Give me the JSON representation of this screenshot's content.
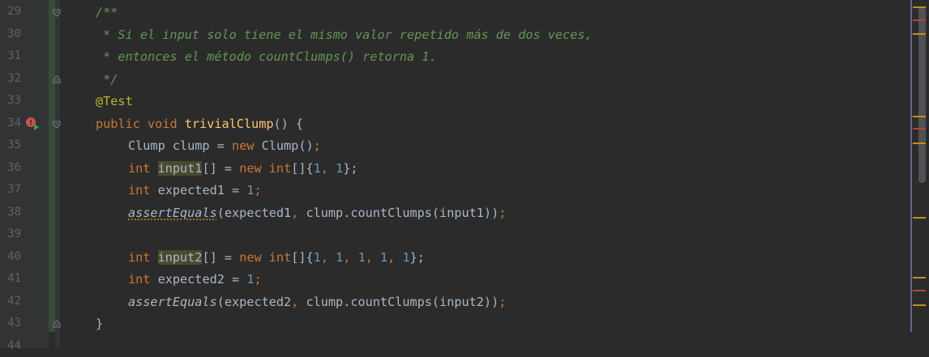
{
  "editor": {
    "line_numbers": [
      "29",
      "30",
      "31",
      "32",
      "33",
      "34",
      "35",
      "36",
      "37",
      "38",
      "39",
      "40",
      "41",
      "42",
      "43",
      "44"
    ],
    "comment_open": "/**",
    "comment_line1": " * Si el input solo tiene el mismo valor repetido más de dos veces,",
    "comment_line2": " * entonces el método countClumps() retorna 1.",
    "comment_close": " */",
    "annotation": "@Test",
    "method": {
      "kw_public": "public",
      "kw_void": "void",
      "name": "trivialClump",
      "rest": "() {"
    },
    "line35": {
      "type": "Clump clump = ",
      "kw_new": "new",
      "rest": " Clump()",
      "semi": ";"
    },
    "line36": {
      "kw_int": "int",
      "var": "input1",
      "brackets": "[] = ",
      "kw_new": "new",
      "kw_int2": "int",
      "arr_open": "[]{",
      "n1": "1",
      "comma": ", ",
      "n2": "1",
      "close": "};"
    },
    "line37": {
      "kw_int": "int",
      "rest": " expected1 = ",
      "num": "1",
      "semi": ";"
    },
    "line38": {
      "fn": "assertEquals",
      "open": "(expected1",
      "comma": ",",
      "rest": " clump.countClumps(input1))",
      "semi": ";"
    },
    "line40": {
      "kw_int": "int",
      "var": "input2",
      "brackets": "[] = ",
      "kw_new": "new",
      "kw_int2": "int",
      "arr_open": "[]{",
      "n1": "1",
      "n2": "1",
      "n3": "1",
      "n4": "1",
      "n5": "1",
      "sep": ", ",
      "close": "};"
    },
    "line41": {
      "kw_int": "int",
      "rest": " expected2 = ",
      "num": "1",
      "semi": ";"
    },
    "line42": {
      "fn": "assertEquals",
      "open": "(expected2",
      "comma": ",",
      "rest": " clump.countClumps(input2))",
      "semi": ";"
    },
    "line43": {
      "brace": "}"
    }
  },
  "gutter_icons": [
    "run-test-failed-icon"
  ],
  "colors": {
    "background": "#2b2b2b",
    "keyword": "#cc7832",
    "number": "#6897bb",
    "comment": "#629755",
    "annotation": "#bbb529",
    "method_name": "#ffc66d",
    "text": "#a9b7c6",
    "warning_mark": "#be9117",
    "error_mark": "#bc3f3c"
  }
}
